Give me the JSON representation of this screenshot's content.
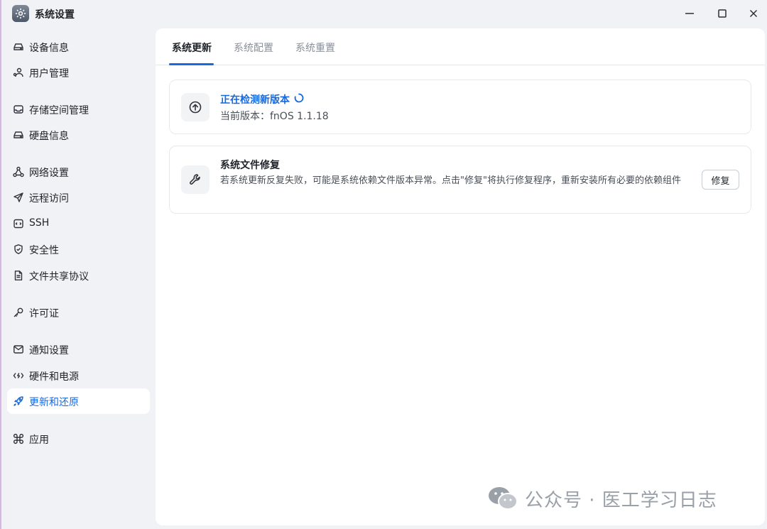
{
  "window": {
    "title": "系统设置",
    "app_icon": "gear-icon"
  },
  "sidebar": {
    "items": [
      {
        "label": "设备信息",
        "icon": "drive-icon"
      },
      {
        "label": "用户管理",
        "icon": "users-icon"
      },
      {
        "label": "存储空间管理",
        "icon": "storage-icon"
      },
      {
        "label": "硬盘信息",
        "icon": "drive-icon"
      },
      {
        "label": "网络设置",
        "icon": "network-icon"
      },
      {
        "label": "远程访问",
        "icon": "send-icon"
      },
      {
        "label": "SSH",
        "icon": "terminal-icon"
      },
      {
        "label": "安全性",
        "icon": "shield-icon"
      },
      {
        "label": "文件共享协议",
        "icon": "document-icon"
      },
      {
        "label": "许可证",
        "icon": "key-icon"
      },
      {
        "label": "通知设置",
        "icon": "mail-icon"
      },
      {
        "label": "硬件和电源",
        "icon": "power-icon"
      },
      {
        "label": "更新和还原",
        "icon": "rocket-icon",
        "active": true
      },
      {
        "label": "应用",
        "icon": "command-icon"
      }
    ]
  },
  "tabs": [
    {
      "label": "系统更新",
      "active": true
    },
    {
      "label": "系统配置"
    },
    {
      "label": "系统重置"
    }
  ],
  "update_card": {
    "title": "正在检测新版本",
    "subtitle": "当前版本：fnOS 1.1.18",
    "icon": "upload-circle-icon"
  },
  "repair_card": {
    "title": "系统文件修复",
    "description": "若系统更新反复失败，可能是系统依赖文件版本异常。点击\"修复\"将执行修复程序，重新安装所有必要的依赖组件",
    "button_label": "修复",
    "icon": "wrench-icon"
  },
  "watermark": {
    "text": "公众号 · 医工学习日志"
  },
  "colors": {
    "accent": "#1769e0",
    "sidebar_bg": "#f1f2f5",
    "panel_bg": "#ffffff"
  }
}
